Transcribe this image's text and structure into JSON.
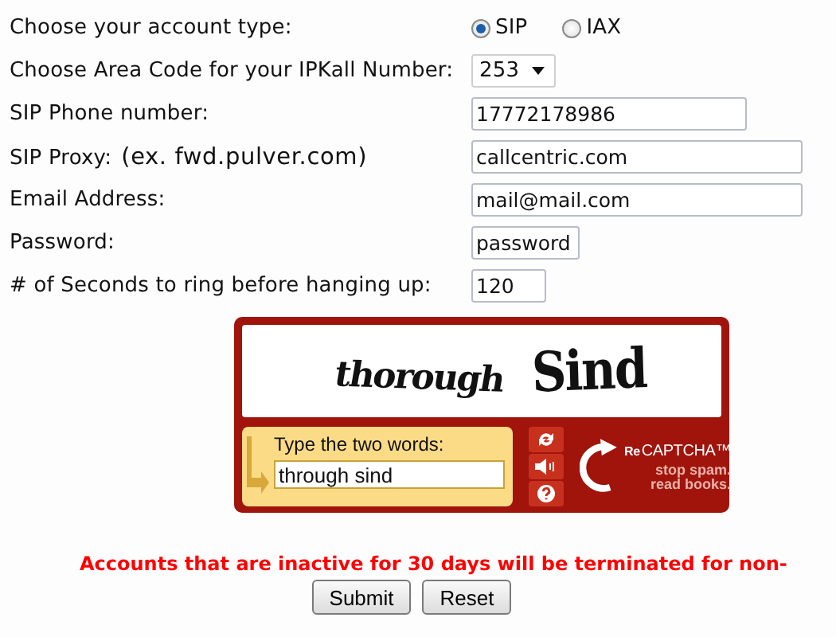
{
  "rows": [
    {
      "kind": "radio",
      "label": "Choose your account type:",
      "options": [
        {
          "label": "SIP",
          "selected": true
        },
        {
          "label": "IAX",
          "selected": false
        }
      ]
    },
    {
      "kind": "select",
      "label": "Choose Area Code for your IPKall Number:",
      "value": "253"
    },
    {
      "kind": "text",
      "label": "SIP Phone number:",
      "value": "17772178986"
    },
    {
      "kind": "text",
      "label": "SIP Proxy:",
      "hint": "(ex. fwd.pulver.com)",
      "value": "callcentric.com"
    },
    {
      "kind": "text",
      "label": "Email Address:",
      "value": "mail@mail.com"
    },
    {
      "kind": "text",
      "label": "Password:",
      "value": "password"
    },
    {
      "kind": "text",
      "label": "# of Seconds to ring before hanging up:",
      "value": "120"
    }
  ],
  "captcha": {
    "words": [
      "thorough",
      "Sind"
    ],
    "prompt": "Type the two words:",
    "answer": "through sind",
    "logo_prefix": "Re",
    "logo": "CAPTCHA™",
    "tagline": [
      "stop spam.",
      "read books."
    ]
  },
  "notice": "Accounts that are inactive for 30 days will be terminated for non-",
  "buttons": [
    "Submit",
    "Reset"
  ]
}
